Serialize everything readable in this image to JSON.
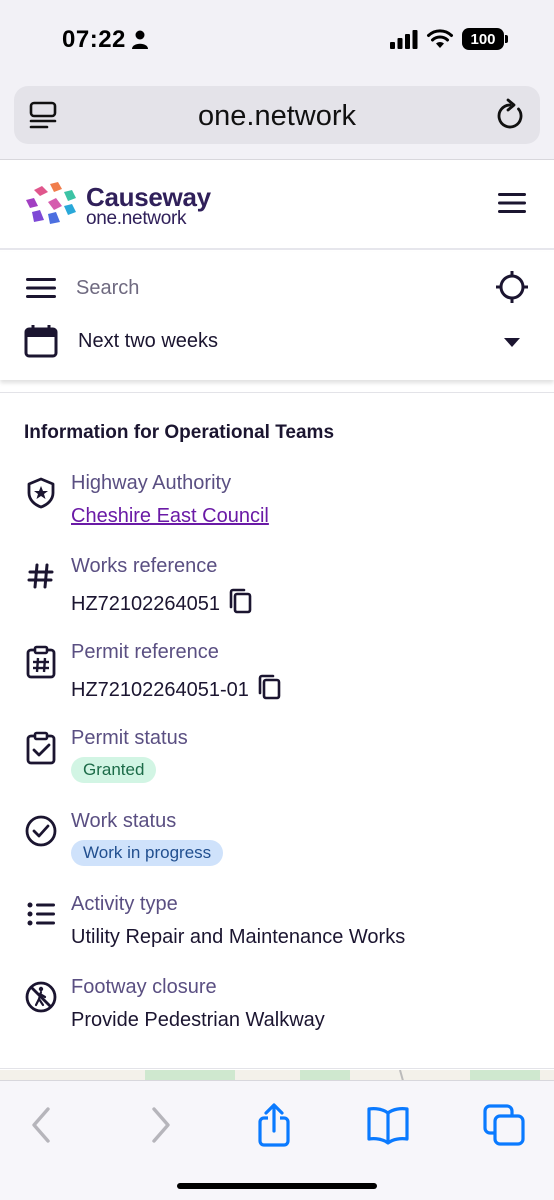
{
  "status_bar": {
    "time": "07:22",
    "battery": "100"
  },
  "browser": {
    "url": "one.network"
  },
  "site": {
    "brand_name": "Causeway",
    "brand_sub": "one.network"
  },
  "search": {
    "placeholder": "Search",
    "date_range": "Next two weeks"
  },
  "info": {
    "title": "Information for Operational Teams",
    "rows": [
      {
        "label": "Highway Authority",
        "value": "Cheshire East Council",
        "icon": "shield-star-icon"
      },
      {
        "label": "Works reference",
        "value": "HZ72102264051",
        "icon": "hash-icon"
      },
      {
        "label": "Permit reference",
        "value": "HZ72102264051-01",
        "icon": "clipboard-hash-icon"
      },
      {
        "label": "Permit status",
        "value": "Granted",
        "icon": "clipboard-check-icon"
      },
      {
        "label": "Work status",
        "value": "Work in progress",
        "icon": "circle-check-icon"
      },
      {
        "label": "Activity type",
        "value": "Utility Repair and Maintenance Works",
        "icon": "list-icon"
      },
      {
        "label": "Footway closure",
        "value": "Provide Pedestrian Walkway",
        "icon": "no-pedestrian-icon"
      }
    ]
  },
  "colors": {
    "brand_text": "#30205a",
    "label": "#5a4f82",
    "link": "#6a1aa6",
    "granted_bg": "#d2f5e4",
    "progress_bg": "#cfe2fb",
    "ios_blue": "#0a7aff"
  }
}
